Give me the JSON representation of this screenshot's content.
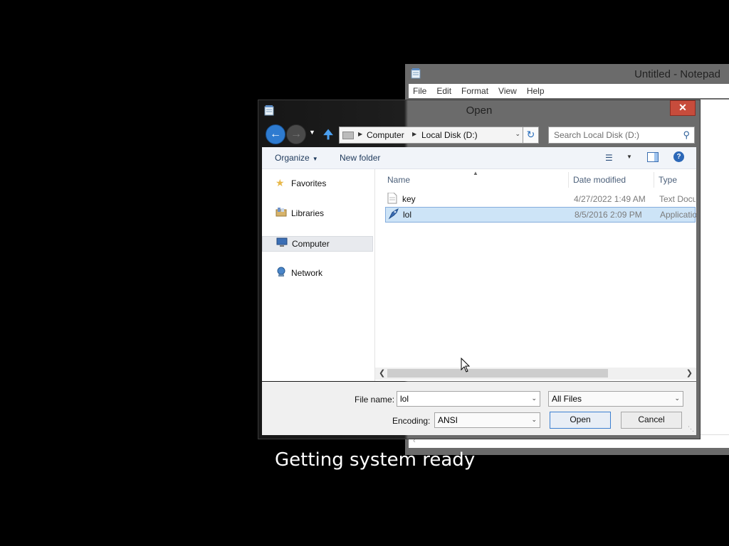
{
  "notepad": {
    "title": "Untitled - Notepad",
    "menu": [
      "File",
      "Edit",
      "Format",
      "View",
      "Help"
    ]
  },
  "dialog": {
    "title": "Open",
    "close_label": "✕",
    "address": {
      "segments": [
        "Computer",
        "Local Disk (D:)"
      ]
    },
    "search_placeholder": "Search Local Disk (D:)",
    "toolbar": {
      "organize": "Organize",
      "new_folder": "New folder",
      "help": "?"
    },
    "nav": {
      "items": [
        {
          "label": "Favorites",
          "icon": "star-icon"
        },
        {
          "label": "Libraries",
          "icon": "library-icon"
        },
        {
          "label": "Computer",
          "icon": "computer-icon"
        },
        {
          "label": "Network",
          "icon": "network-icon"
        }
      ]
    },
    "columns": [
      "Name",
      "Date modified",
      "Type"
    ],
    "files": [
      {
        "name": "key",
        "date": "4/27/2022 1:49 AM",
        "type": "Text Document",
        "icon": "text-file-icon"
      },
      {
        "name": "lol",
        "date": "8/5/2016 2:09 PM",
        "type": "Application",
        "icon": "application-icon"
      }
    ],
    "file_name_label": "File name:",
    "file_name_value": "lol",
    "filter_value": "All Files",
    "encoding_label": "Encoding:",
    "encoding_value": "ANSI",
    "open_label": "Open",
    "cancel_label": "Cancel"
  },
  "status_text": "Getting system ready"
}
